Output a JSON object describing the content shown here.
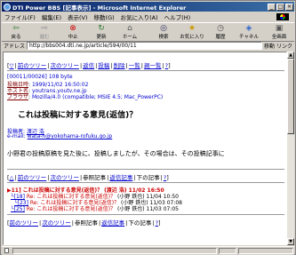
{
  "window": {
    "title": "DTI Power BBS [記事表示] - Microsoft Internet Explorer",
    "buttons": [
      "_",
      "□",
      "×"
    ]
  },
  "menu": [
    "ファイル(F)",
    "編集(E)",
    "表示(V)",
    "移動(G)",
    "お気に入り(A)",
    "ヘルプ(H)"
  ],
  "toolbar": [
    {
      "label": "戻る",
      "icon": "back-arrow-icon",
      "glyph": "⇦"
    },
    {
      "label": "進む",
      "icon": "forward-arrow-icon",
      "glyph": "⇨"
    },
    {
      "label": "中止",
      "icon": "stop-icon",
      "glyph": "⊗"
    },
    {
      "label": "更新",
      "icon": "refresh-icon",
      "glyph": "↻"
    },
    {
      "label": "ホーム",
      "icon": "home-icon",
      "glyph": "⌂"
    },
    {
      "label": "検索",
      "icon": "search-icon",
      "glyph": "◎"
    },
    {
      "label": "お気に入り",
      "icon": "favorites-icon",
      "glyph": "★"
    },
    {
      "label": "履歴",
      "icon": "history-icon",
      "glyph": "◷"
    },
    {
      "label": "チャネル",
      "icon": "channels-icon",
      "glyph": "◈"
    },
    {
      "label": "全画面",
      "icon": "fullscreen-icon",
      "glyph": "▣"
    }
  ],
  "address": {
    "label": "アドレス",
    "url": "http://bbs004.dti.ne.jp/article/594/00/11",
    "go": "移動",
    "links": "リンク"
  },
  "nav_top": {
    "items": [
      "▽",
      "前のツリー",
      "次のツリー",
      "返信",
      "投稿",
      "削除",
      "一覧",
      "親一覧",
      "?"
    ]
  },
  "article": {
    "id_line": "[00011/00026]",
    "size": "108 byte",
    "date_label": "投稿日時",
    "date": "1999/11/02 16:50:02",
    "host_label": "ホスト名",
    "host": "youtrans.youtv.ne.jp",
    "browser_label": "ブラウザ",
    "browser": "Mozilla/4.0 (compatible; MSIE 4.5; Mac_PowerPC)",
    "subject": "これは投稿に対する意見(返信)？",
    "author_label": "投稿者",
    "author": "渡辺 浩",
    "email_label": "e-mail",
    "email": "wata-h@yokohama-rofuku.go.jp",
    "body": "小野君の投稿原稿を見た後に、投稿しましたが、その場合は、その投稿記事に"
  },
  "nav_bottom": {
    "items": [
      "△",
      "前のツリー",
      "次のツリー",
      "参照記事",
      "返信記事",
      "下の記事",
      "?"
    ]
  },
  "tree": [
    {
      "marker": "▶11]",
      "subject": "これは投稿に対する意見(返信)？",
      "author": "(渡辺 浩)",
      "date": "11/02 16:50"
    },
    {
      "marker": "└[18]",
      "subject": "Re: これは投稿に対する意見(返信)？",
      "author": "(小野 鉄也)",
      "date": "11/04 10:50"
    },
    {
      "marker": "└[23]",
      "subject": "Re: これは投稿に対する意見(返信)？",
      "author": "(小野 鉄也)",
      "date": "11/03 07:08"
    },
    {
      "marker": "└[25]",
      "subject": "Re: これは投稿に対する意見(返信)？",
      "author": "(小野 鉄也)",
      "date": "11/03 07:05"
    }
  ],
  "nav_footer": {
    "items": [
      "前のツリー",
      "次のツリー",
      "参照記事",
      "返信記事",
      "下の記事",
      "?"
    ]
  }
}
